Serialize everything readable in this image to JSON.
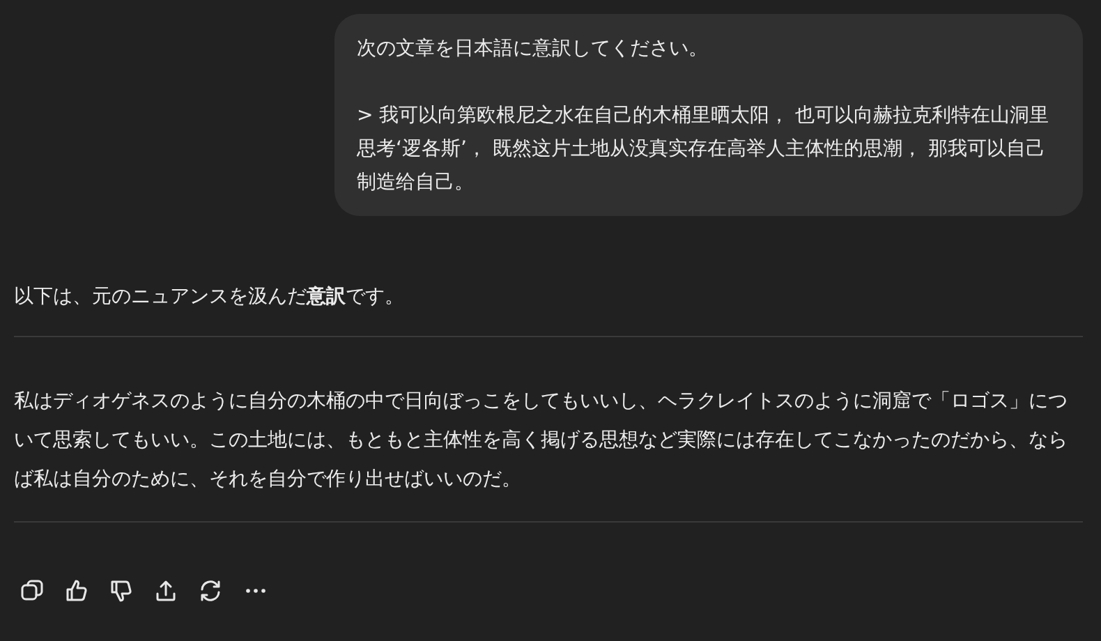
{
  "user_message": {
    "lines": [
      "次の文章を日本語に意訳してください。",
      "> 我可以向第欧根尼之水在自己的木桶里晒太阳， 也可以向赫拉克利特在山洞里思考‘逻各斯’， 既然这片土地从没真实存在高举人主体性的思潮， 那我可以自己制造给自己。"
    ]
  },
  "assistant_message": {
    "intro": "以下は、元のニュアンスを汲んだ**意訳**です。",
    "translation": "私はディオゲネスのように自分の木桶の中で日向ぼっこをしてもいいし、ヘラクレイトスのように洞窟で「ロゴス」について思索してもいい。この土地には、もともと主体性を高く掲げる思想など実際には存在してこなかったのだから、ならば私は自分のために、それを自分で作り出せばいいのだ。"
  }
}
